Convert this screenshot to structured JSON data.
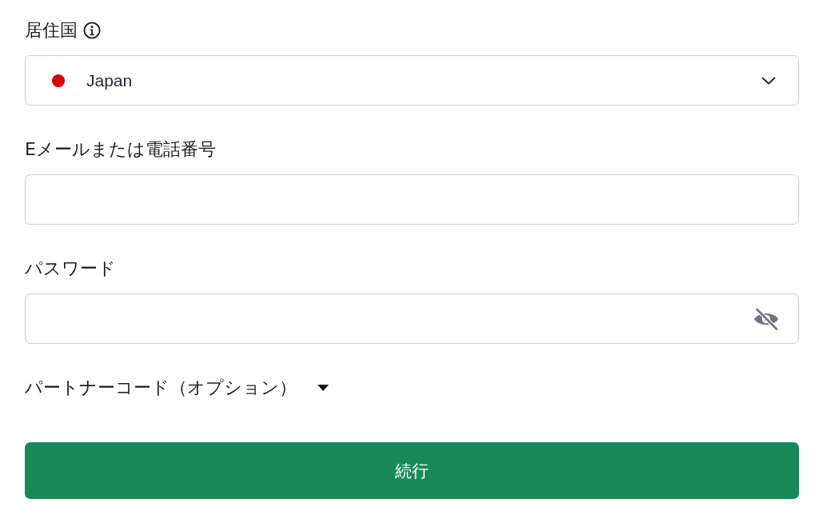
{
  "form": {
    "fields": [
      {
        "kind": "select",
        "label": "居住国",
        "info": true,
        "value": "Japan"
      },
      {
        "kind": "text",
        "label": "Eメールまたは電話番号",
        "info": false
      },
      {
        "kind": "password",
        "label": "パスワード",
        "info": false,
        "revealed": false
      }
    ],
    "partner_code_toggle": {
      "label": "パートナーコード（オプション）",
      "expanded": false
    },
    "submit_button": {
      "label": "続行"
    }
  }
}
